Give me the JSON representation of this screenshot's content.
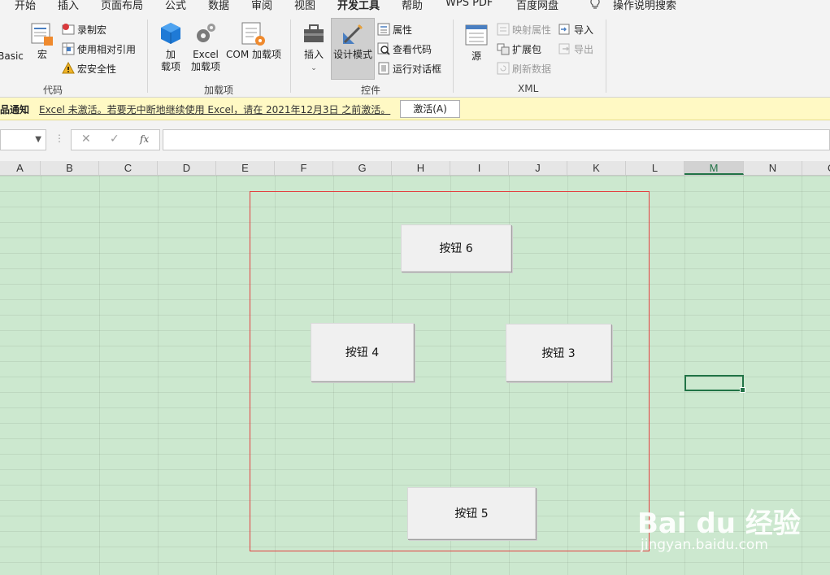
{
  "ribbon_tabs": [
    {
      "label": "开始"
    },
    {
      "label": "插入"
    },
    {
      "label": "页面布局"
    },
    {
      "label": "公式"
    },
    {
      "label": "数据"
    },
    {
      "label": "审阅"
    },
    {
      "label": "视图"
    },
    {
      "label": "开发工具",
      "active": true
    },
    {
      "label": "帮助"
    },
    {
      "label": "WPS PDF"
    },
    {
      "label": "百度网盘"
    }
  ],
  "tell_me": {
    "label": "操作说明搜索",
    "icon": "lightbulb-icon"
  },
  "groups": {
    "code": {
      "label": "代码",
      "visual_basic": "Basic",
      "macros": "宏",
      "record_macro": "录制宏",
      "relative_ref": "使用相对引用",
      "macro_security": "宏安全性"
    },
    "addins": {
      "label": "加载项",
      "addins_line1": "加",
      "addins_line2": "载项",
      "excel_addins_line1": "Excel",
      "excel_addins_line2": "加载项",
      "com_addins": "COM 加载项"
    },
    "controls": {
      "label": "控件",
      "insert": "插入",
      "design_mode": "设计模式",
      "properties": "属性",
      "view_code": "查看代码",
      "run_dialog": "运行对话框"
    },
    "xml": {
      "label": "XML",
      "source": "源",
      "map_properties": "映射属性",
      "expansion_packs": "扩展包",
      "refresh_data": "刷新数据",
      "import": "导入",
      "export": "导出"
    }
  },
  "message_bar": {
    "title": "品通知",
    "text": "Excel 未激活。若要无中断地继续使用 Excel，请在 2021年12月3日 之前激活。",
    "button": "激活(A)"
  },
  "formula_bar": {
    "name_box": "",
    "formula": "",
    "fx_label": "fx"
  },
  "columns": [
    "A",
    "B",
    "C",
    "D",
    "E",
    "F",
    "G",
    "H",
    "I",
    "J",
    "K",
    "L",
    "M",
    "N",
    "O"
  ],
  "selected_column": "M",
  "form_buttons": {
    "b6": "按钮 6",
    "b4": "按钮 4",
    "b3": "按钮 3",
    "b5": "按钮 5"
  },
  "watermark": {
    "logo": "Bai du 经验",
    "url": "jingyan.baidu.com"
  }
}
